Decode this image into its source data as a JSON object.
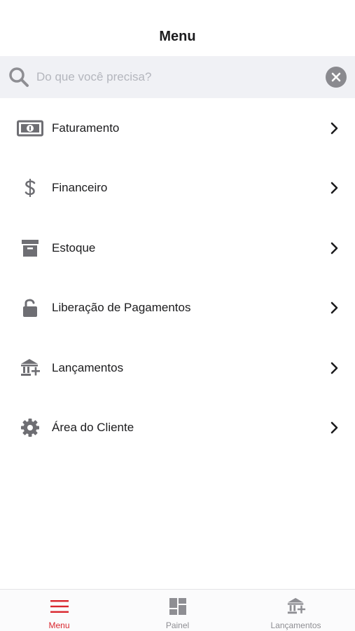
{
  "header": {
    "title": "Menu"
  },
  "search": {
    "placeholder": "Do que você precisa?"
  },
  "menu": {
    "items": [
      {
        "label": "Faturamento",
        "icon": "money-bill-icon"
      },
      {
        "label": "Financeiro",
        "icon": "dollar-icon"
      },
      {
        "label": "Estoque",
        "icon": "archive-box-icon"
      },
      {
        "label": "Liberação de Pagamentos",
        "icon": "unlock-icon"
      },
      {
        "label": "Lançamentos",
        "icon": "bank-plus-icon"
      },
      {
        "label": "Área do Cliente",
        "icon": "gear-icon"
      }
    ]
  },
  "tabbar": {
    "tabs": [
      {
        "label": "Menu",
        "icon": "hamburger-icon",
        "active": true
      },
      {
        "label": "Painel",
        "icon": "dashboard-icon",
        "active": false
      },
      {
        "label": "Lançamentos",
        "icon": "bank-plus-icon",
        "active": false
      }
    ]
  },
  "colors": {
    "accent": "#d9262e",
    "icon_gray": "#6e6e73",
    "search_bg": "#f0f1f5"
  }
}
